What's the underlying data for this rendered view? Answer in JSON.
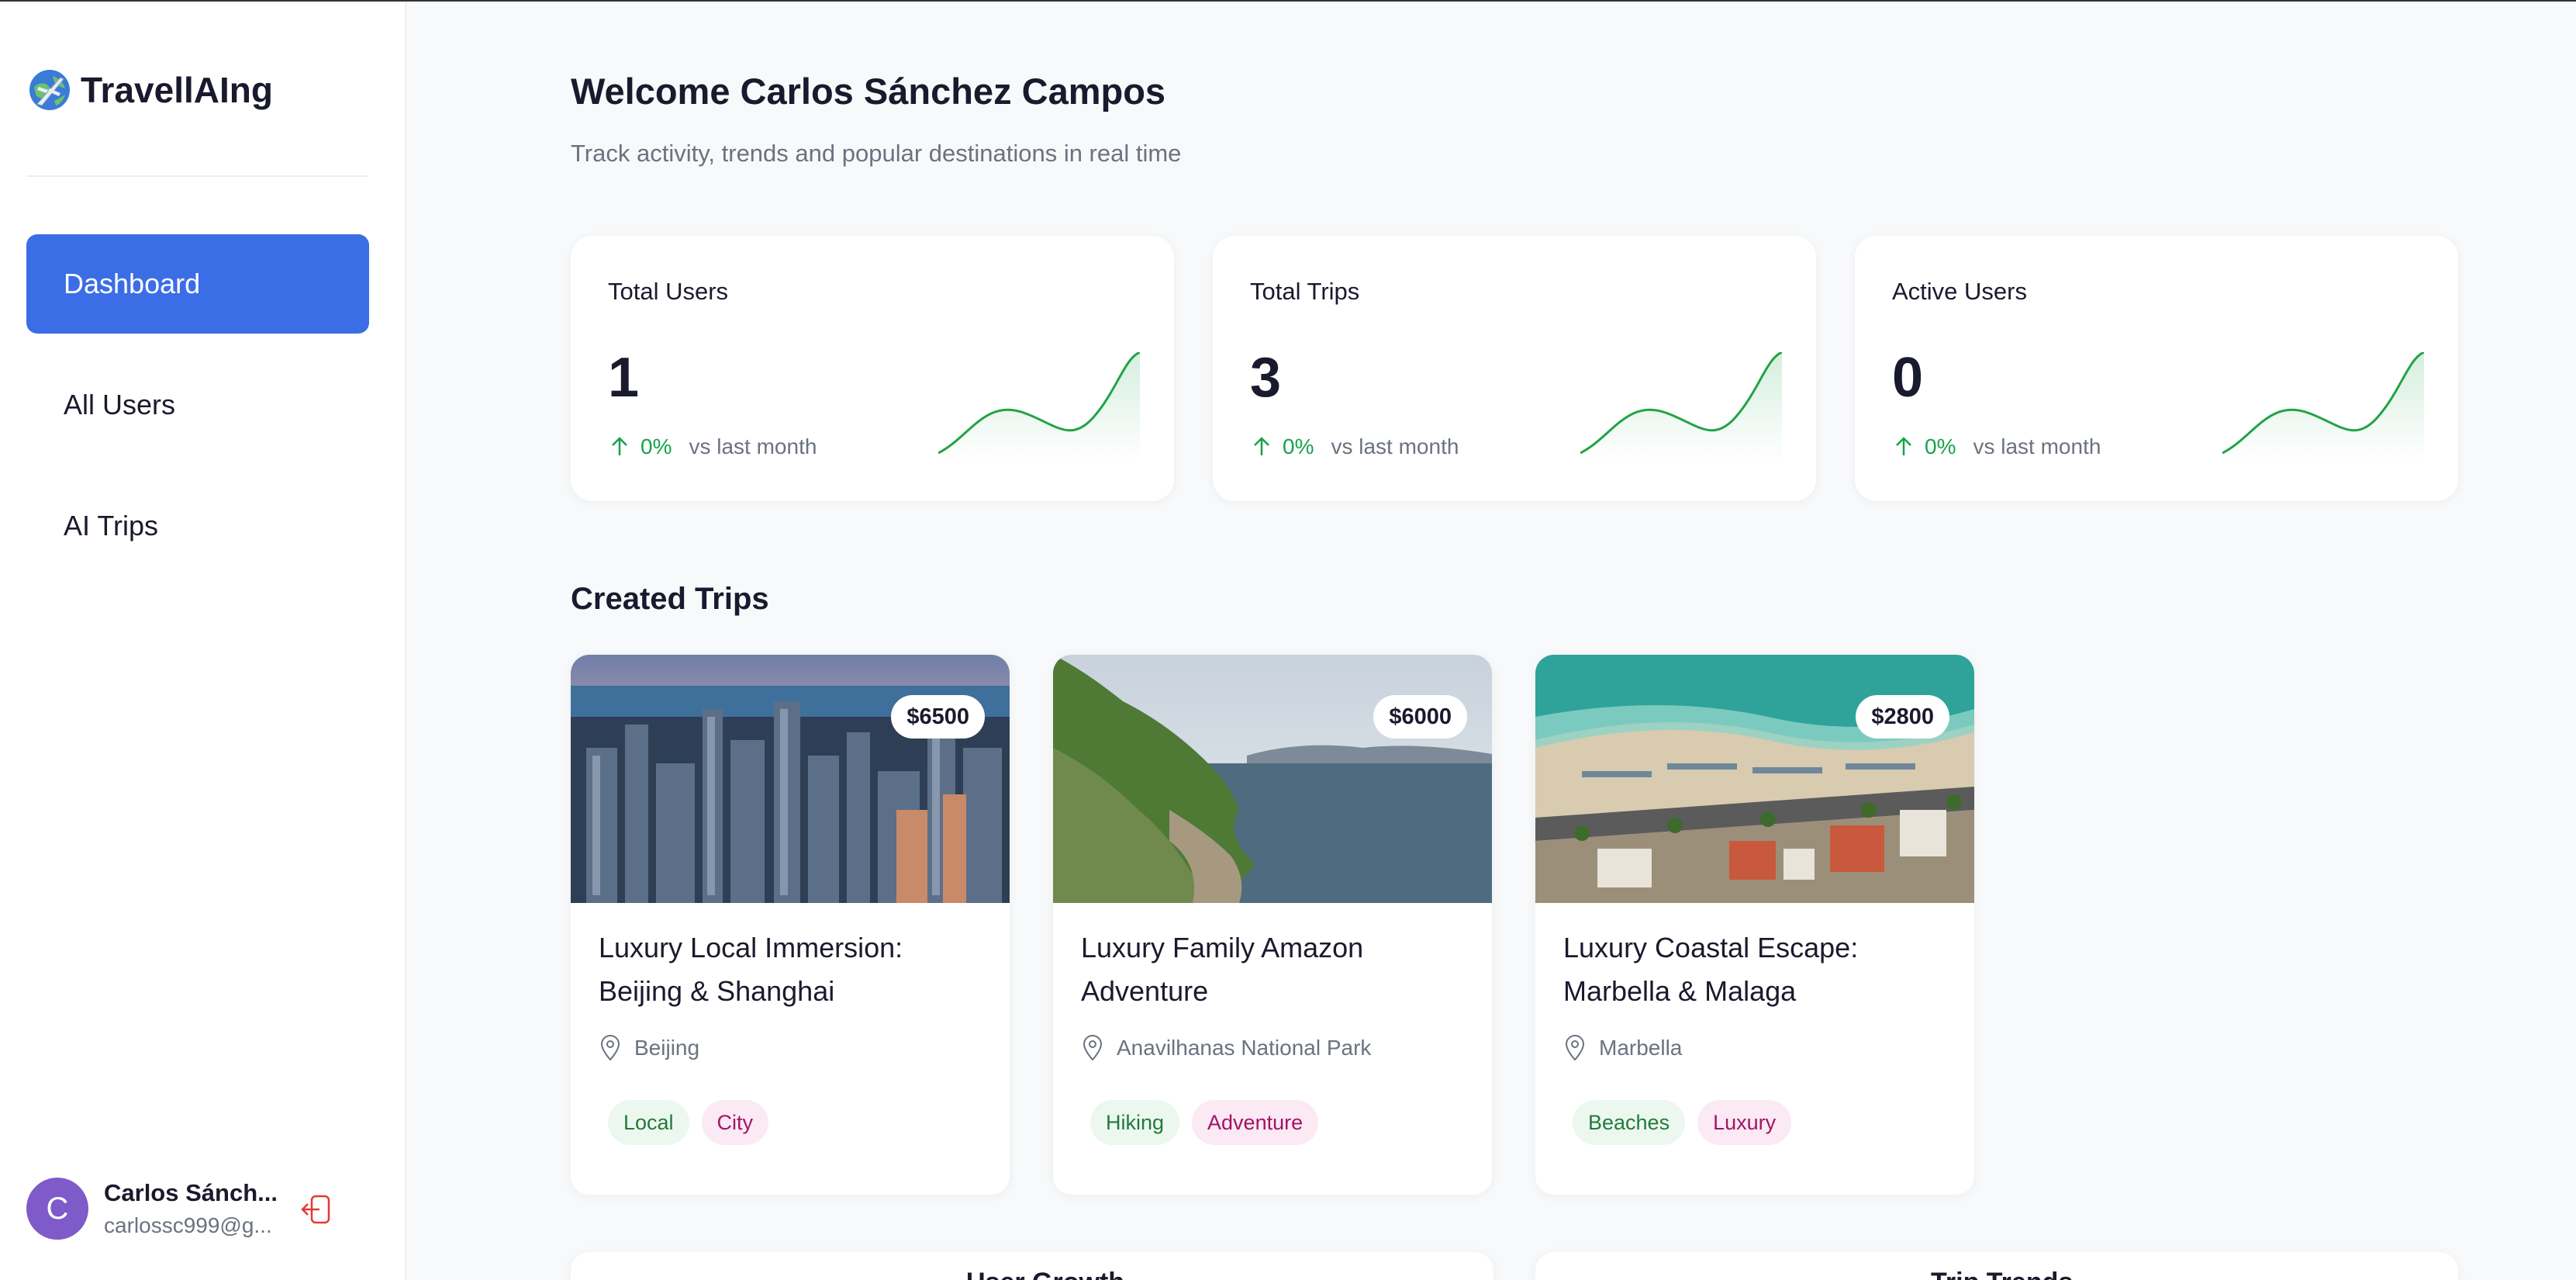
{
  "app": {
    "name": "TravellAIng",
    "logo_icon": "globe-plane-icon"
  },
  "sidebar": {
    "items": [
      {
        "label": "Dashboard",
        "active": true
      },
      {
        "label": "All Users",
        "active": false
      },
      {
        "label": "AI Trips",
        "active": false
      }
    ]
  },
  "user": {
    "initial": "C",
    "name": "Carlos Sánch...",
    "email": "carlossc999@g...",
    "avatar_color": "#7e5bc8"
  },
  "header": {
    "title": "Welcome Carlos Sánchez Campos",
    "subtitle": "Track activity, trends and popular destinations in real time"
  },
  "stats": [
    {
      "label": "Total Users",
      "value": "1",
      "change": "0%",
      "compare": "vs last month"
    },
    {
      "label": "Total Trips",
      "value": "3",
      "change": "0%",
      "compare": "vs last month"
    },
    {
      "label": "Active Users",
      "value": "0",
      "change": "0%",
      "compare": "vs last month"
    }
  ],
  "created_trips": {
    "title": "Created Trips",
    "items": [
      {
        "title": "Luxury Local Immersion: Beijing & Shanghai",
        "price": "$6500",
        "location": "Beijing",
        "tags": [
          "Local",
          "City"
        ],
        "image": "city-skyline-image"
      },
      {
        "title": "Luxury Family Amazon Adventure",
        "price": "$6000",
        "location": "Anavilhanas National Park",
        "tags": [
          "Hiking",
          "Adventure"
        ],
        "image": "coastline-image"
      },
      {
        "title": "Luxury Coastal Escape: Marbella & Malaga",
        "price": "$2800",
        "location": "Marbella",
        "tags": [
          "Beaches",
          "Luxury"
        ],
        "image": "beach-aerial-image"
      }
    ]
  },
  "bottom": {
    "user_growth": "User Growth",
    "trip_trends": "Trip Trends"
  },
  "colors": {
    "accent": "#3b6de6",
    "positive": "#16a34a",
    "tag_green": "#237a3b",
    "tag_pink": "#a31466"
  }
}
